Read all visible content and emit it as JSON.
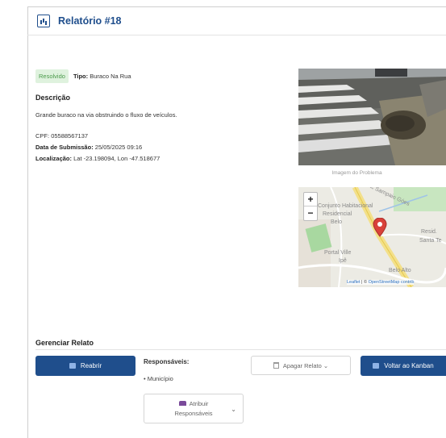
{
  "header": {
    "title": "Relatório #18",
    "icon": "report-icon"
  },
  "report": {
    "status": "Resolvido",
    "tipo_label": "Tipo:",
    "tipo_value": "Buraco Na Rua",
    "descricao_heading": "Descrição",
    "descricao_text": "Grande buraco na via obstruindo o fluxo de veículos.",
    "cpf_label": "CPF:",
    "cpf_value": "05588567137",
    "data_label": "Data de Submissão:",
    "data_value": "25/05/2025 09:16",
    "local_label": "Localização:",
    "local_value": "Lat -23.198094, Lon -47.518677"
  },
  "photo": {
    "caption": "Imagem do Problema"
  },
  "map": {
    "labels": [
      "Pic Sampaio Góes",
      "Conjunto Habitacional",
      "Residencial",
      "Belo",
      "Portal Ville",
      "Ipê",
      "Belo Alto",
      "Resid.",
      "Santa Te"
    ],
    "zoom_in": "+",
    "zoom_out": "−",
    "attribution_leaflet": "Leaflet",
    "attribution_sep": " | © ",
    "attribution_osm": "OpenStreetMap contrib"
  },
  "manage": {
    "title": "Gerenciar Relato",
    "reopen_label": "Reabrir",
    "responsaveis_label": "Responsáveis:",
    "responsaveis": [
      "• Município"
    ],
    "assign_line1": "Atribuir",
    "assign_line2": "Responsáveis",
    "delete_label": "Apagar Relato ⌄",
    "back_label": "Voltar ao Kanban"
  },
  "colors": {
    "primary": "#1f4e8c",
    "badge_bg": "#dff2de",
    "badge_text": "#4a9a4a",
    "marker": "#d9413a"
  }
}
